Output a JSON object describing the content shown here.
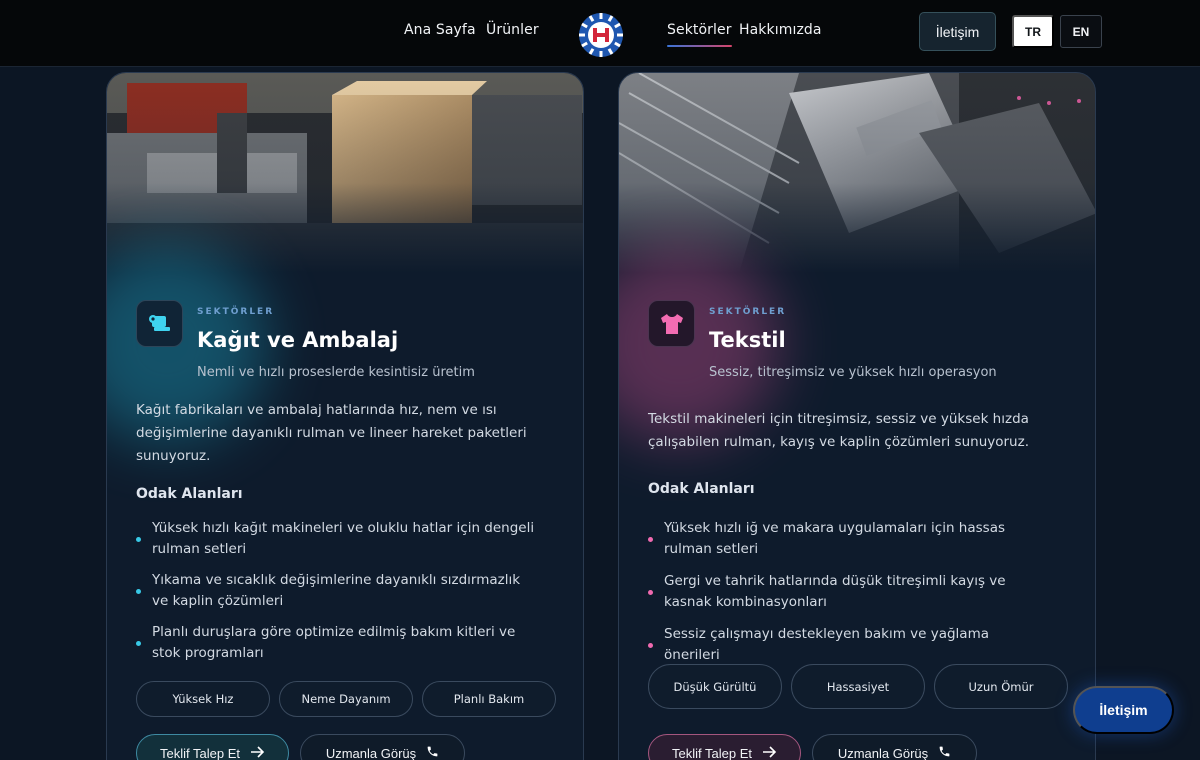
{
  "nav": {
    "links": [
      "Ana Sayfa",
      "Ürünler",
      "Sektörler",
      "Hakkımızda"
    ],
    "contact_label": "İletişim",
    "lang_tr": "TR",
    "lang_en": "EN"
  },
  "cards": [
    {
      "eyebrow": "SEKTÖRLER",
      "title": "Kağıt ve Ambalaj",
      "subtitle": "Nemli ve hızlı proseslerde kesintisiz üretim",
      "description": "Kağıt fabrikaları ve ambalaj hatlarında hız, nem ve ısı değişimlerine dayanıklı rulman ve lineer hareket paketleri sunuyoruz.",
      "focus_heading": "Odak Alanları",
      "bullets": [
        "Yüksek hızlı kağıt makineleri ve oluklu hatlar için dengeli rulman setleri",
        "Yıkama ve sıcaklık değişimlerine dayanıklı sızdırmazlık ve kaplin çözümleri",
        "Planlı duruşlara göre optimize edilmiş bakım kitleri ve stok programları"
      ],
      "tags": [
        "Yüksek Hız",
        "Neme Dayanım",
        "Planlı Bakım"
      ],
      "cta_primary": "Teklif Talep Et",
      "cta_secondary": "Uzmanla Görüş",
      "accent": "#38c9e6",
      "icon": "paper-roll-icon"
    },
    {
      "eyebrow": "SEKTÖRLER",
      "title": "Tekstil",
      "subtitle": "Sessiz, titreşimsiz ve yüksek hızlı operasyon",
      "description": "Tekstil makineleri için titreşimsiz, sessiz ve yüksek hızda çalışabilen rulman, kayış ve kaplin çözümleri sunuyoruz.",
      "focus_heading": "Odak Alanları",
      "bullets": [
        "Yüksek hızlı iğ ve makara uygulamaları için hassas rulman setleri",
        "Gergi ve tahrik hatlarında düşük titreşimli kayış ve kasnak kombinasyonları",
        "Sessiz çalışmayı destekleyen bakım ve yağlama önerileri"
      ],
      "tags": [
        "Düşük Gürültü",
        "Hassasiyet",
        "Uzun Ömür"
      ],
      "cta_primary": "Teklif Talep Et",
      "cta_secondary": "Uzmanla Görüş",
      "accent": "#f06ab0",
      "icon": "tshirt-icon"
    }
  ],
  "floating_contact": "İletişim"
}
